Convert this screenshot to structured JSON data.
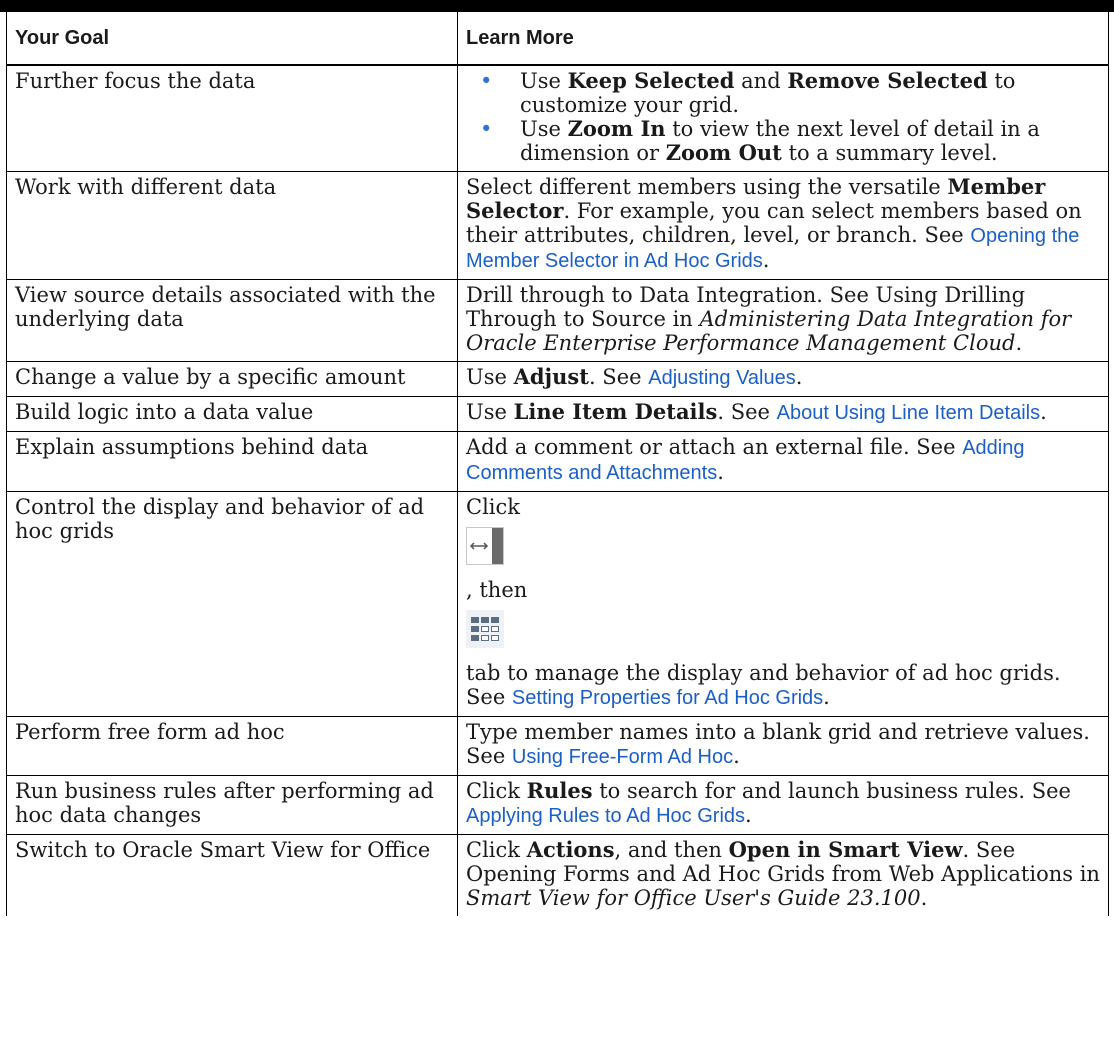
{
  "header": {
    "col1": "Your Goal",
    "col2": "Learn More"
  },
  "rows": {
    "r1": {
      "goal": "Further focus the data",
      "b1": {
        "t1": "Use ",
        "s1": "Keep Selected",
        "t2": " and ",
        "s2": "Remove Selected",
        "t3": " to customize your grid."
      },
      "b2": {
        "t1": "Use ",
        "s1": "Zoom In",
        "t2": " to view the next level of detail in a dimension or ",
        "s2": "Zoom Out",
        "t3": " to a summary level."
      }
    },
    "r2": {
      "goal": "Work with different data",
      "t1": "Select different members using the versatile ",
      "s1": "Member Selector",
      "t2": ". For example, you can select members based on their attributes, children, level, or branch. See ",
      "link": "Opening the Member Selector in Ad Hoc Grids",
      "t3": "."
    },
    "r3": {
      "goal": "View source details associated with the underlying data",
      "t1": "Drill through to Data Integration. See Using Drilling Through to Source in ",
      "i1": "Administering Data Integration for Oracle Enterprise Performance Management Cloud",
      "t2": "."
    },
    "r4": {
      "goal": "Change a value by a specific amount",
      "t1": "Use ",
      "s1": "Adjust",
      "t2": ". See ",
      "link": "Adjusting Values",
      "t3": "."
    },
    "r5": {
      "goal": "Build logic into a data value",
      "t1": "Use ",
      "s1": "Line Item Details",
      "t2": ". See ",
      "link": "About Using Line Item Details",
      "t3": "."
    },
    "r6": {
      "goal": "Explain assumptions behind data",
      "t1": "Add a comment or attach an external file. See ",
      "link": "Adding Comments and Attachments",
      "t2": "."
    },
    "r7": {
      "goal": "Control the display and behavior of ad hoc grids",
      "t1": "Click",
      "t2": ", then",
      "t3": "tab to manage the display and behavior of ad hoc grids. See ",
      "link": "Setting Properties for Ad Hoc Grids",
      "t4": ".",
      "icon1": "panel-toggle-icon",
      "icon2": "grid-properties-icon"
    },
    "r8": {
      "goal": "Perform free form ad hoc",
      "t1": "Type member names into a blank grid and retrieve values. See ",
      "link": "Using Free-Form Ad Hoc",
      "t2": "."
    },
    "r9": {
      "goal": "Run business rules after performing ad hoc data changes",
      "t1": "Click ",
      "s1": "Rules",
      "t2": " to search for and launch business rules. See ",
      "link": "Applying Rules to Ad Hoc Grids",
      "t3": "."
    },
    "r10": {
      "goal": "Switch to Oracle Smart View for Office",
      "t1": "Click ",
      "s1": "Actions",
      "t2": ", and then ",
      "s2": "Open in Smart View",
      "t3": ". See Opening Forms and Ad Hoc Grids from Web Applications in ",
      "i1": "Smart View for Office User's Guide 23.100",
      "t4": "."
    }
  },
  "colors": {
    "link": "#1a5fc8",
    "bullet": "#2e6fd8",
    "rule": "#000000"
  }
}
